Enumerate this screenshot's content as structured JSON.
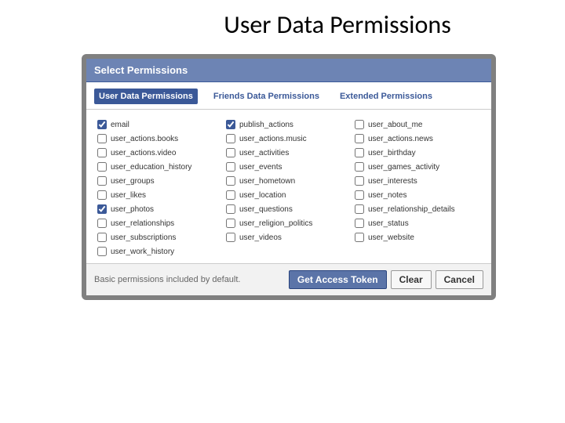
{
  "slide": {
    "title": "User Data Permissions"
  },
  "dialog": {
    "header": "Select Permissions",
    "tabs": [
      {
        "label": "User Data Permissions",
        "active": true
      },
      {
        "label": "Friends Data Permissions",
        "active": false
      },
      {
        "label": "Extended Permissions",
        "active": false
      }
    ],
    "permissions": [
      [
        {
          "label": "email",
          "checked": true
        },
        {
          "label": "publish_actions",
          "checked": true
        },
        {
          "label": "user_about_me",
          "checked": false
        }
      ],
      [
        {
          "label": "user_actions.books",
          "checked": false
        },
        {
          "label": "user_actions.music",
          "checked": false
        },
        {
          "label": "user_actions.news",
          "checked": false
        }
      ],
      [
        {
          "label": "user_actions.video",
          "checked": false
        },
        {
          "label": "user_activities",
          "checked": false
        },
        {
          "label": "user_birthday",
          "checked": false
        }
      ],
      [
        {
          "label": "user_education_history",
          "checked": false
        },
        {
          "label": "user_events",
          "checked": false
        },
        {
          "label": "user_games_activity",
          "checked": false
        }
      ],
      [
        {
          "label": "user_groups",
          "checked": false
        },
        {
          "label": "user_hometown",
          "checked": false
        },
        {
          "label": "user_interests",
          "checked": false
        }
      ],
      [
        {
          "label": "user_likes",
          "checked": false
        },
        {
          "label": "user_location",
          "checked": false
        },
        {
          "label": "user_notes",
          "checked": false
        }
      ],
      [
        {
          "label": "user_photos",
          "checked": true
        },
        {
          "label": "user_questions",
          "checked": false
        },
        {
          "label": "user_relationship_details",
          "checked": false
        }
      ],
      [
        {
          "label": "user_relationships",
          "checked": false
        },
        {
          "label": "user_religion_politics",
          "checked": false
        },
        {
          "label": "user_status",
          "checked": false
        }
      ],
      [
        {
          "label": "user_subscriptions",
          "checked": false
        },
        {
          "label": "user_videos",
          "checked": false
        },
        {
          "label": "user_website",
          "checked": false
        }
      ],
      [
        {
          "label": "user_work_history",
          "checked": false
        }
      ]
    ],
    "footer_note": "Basic permissions included by default.",
    "buttons": {
      "primary": "Get Access Token",
      "clear": "Clear",
      "cancel": "Cancel"
    }
  }
}
